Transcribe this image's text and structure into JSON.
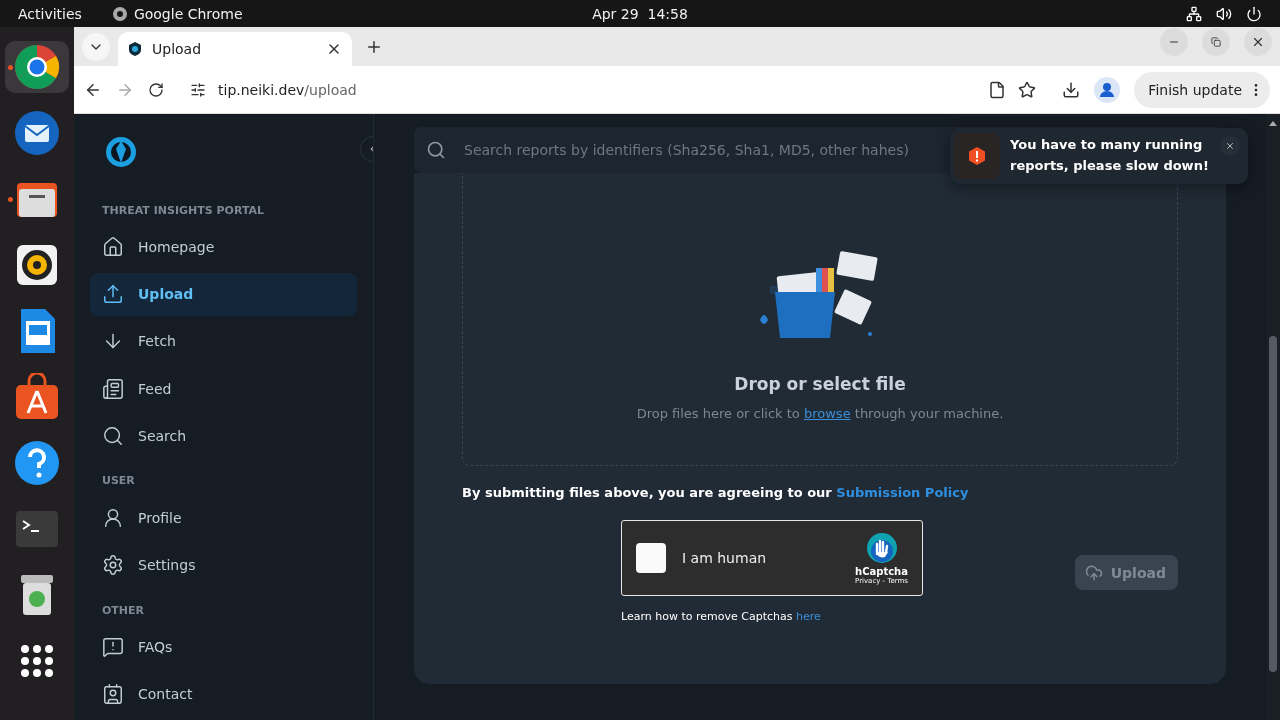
{
  "top_bar": {
    "activities": "Activities",
    "app": "Google Chrome",
    "clock": "Apr 29  14:58"
  },
  "dock": [
    {
      "kind": "chrome",
      "running": true,
      "selected": true
    },
    {
      "kind": "mail",
      "running": false,
      "selected": false
    },
    {
      "kind": "files",
      "running": true,
      "selected": false
    },
    {
      "kind": "music",
      "running": false,
      "selected": false
    },
    {
      "kind": "writer",
      "running": false,
      "selected": false
    },
    {
      "kind": "store",
      "running": false,
      "selected": false
    },
    {
      "kind": "help",
      "running": false,
      "selected": false
    },
    {
      "kind": "terminal",
      "running": false,
      "selected": false
    },
    {
      "kind": "trash",
      "running": false,
      "selected": false
    },
    {
      "kind": "apps",
      "running": false,
      "selected": false
    }
  ],
  "browser": {
    "tab": {
      "title": "Upload"
    },
    "url": {
      "host": "tip.neiki.dev",
      "path": "/upload"
    },
    "update_button": "Finish update"
  },
  "sidebar": {
    "sections": [
      {
        "heading": "THREAT INSIGHTS PORTAL",
        "items": [
          {
            "label": "Homepage",
            "kind": "home",
            "selected": false
          },
          {
            "label": "Upload",
            "kind": "upload",
            "selected": true
          },
          {
            "label": "Fetch",
            "kind": "fetch",
            "selected": false
          },
          {
            "label": "Feed",
            "kind": "feed",
            "selected": false
          },
          {
            "label": "Search",
            "kind": "search",
            "selected": false
          }
        ]
      },
      {
        "heading": "USER",
        "items": [
          {
            "label": "Profile",
            "kind": "profile",
            "selected": false
          },
          {
            "label": "Settings",
            "kind": "settings",
            "selected": false
          }
        ]
      },
      {
        "heading": "OTHER",
        "items": [
          {
            "label": "FAQs",
            "kind": "faq",
            "selected": false
          },
          {
            "label": "Contact",
            "kind": "contact",
            "selected": false
          }
        ]
      }
    ]
  },
  "search": {
    "placeholder": "Search reports by identifiers (Sha256, Sha1, MD5, other hahes)"
  },
  "toast": {
    "message": "You have to many running reports, please slow down!"
  },
  "dropzone": {
    "title": "Drop or select file",
    "text_before": "Drop files here or click to",
    "link": "browse",
    "text_after": "through your machine."
  },
  "agreement": {
    "text": "By submitting files above, you are agreeing to our",
    "link": "Submission Policy"
  },
  "captcha": {
    "label": "I am human",
    "checked": false,
    "brand": "hCaptcha",
    "links": "Privacy - Terms"
  },
  "captcha_help": {
    "text": "Learn how to remove Captchas",
    "link": "here"
  },
  "upload_button": {
    "label": "Upload",
    "disabled": true
  }
}
